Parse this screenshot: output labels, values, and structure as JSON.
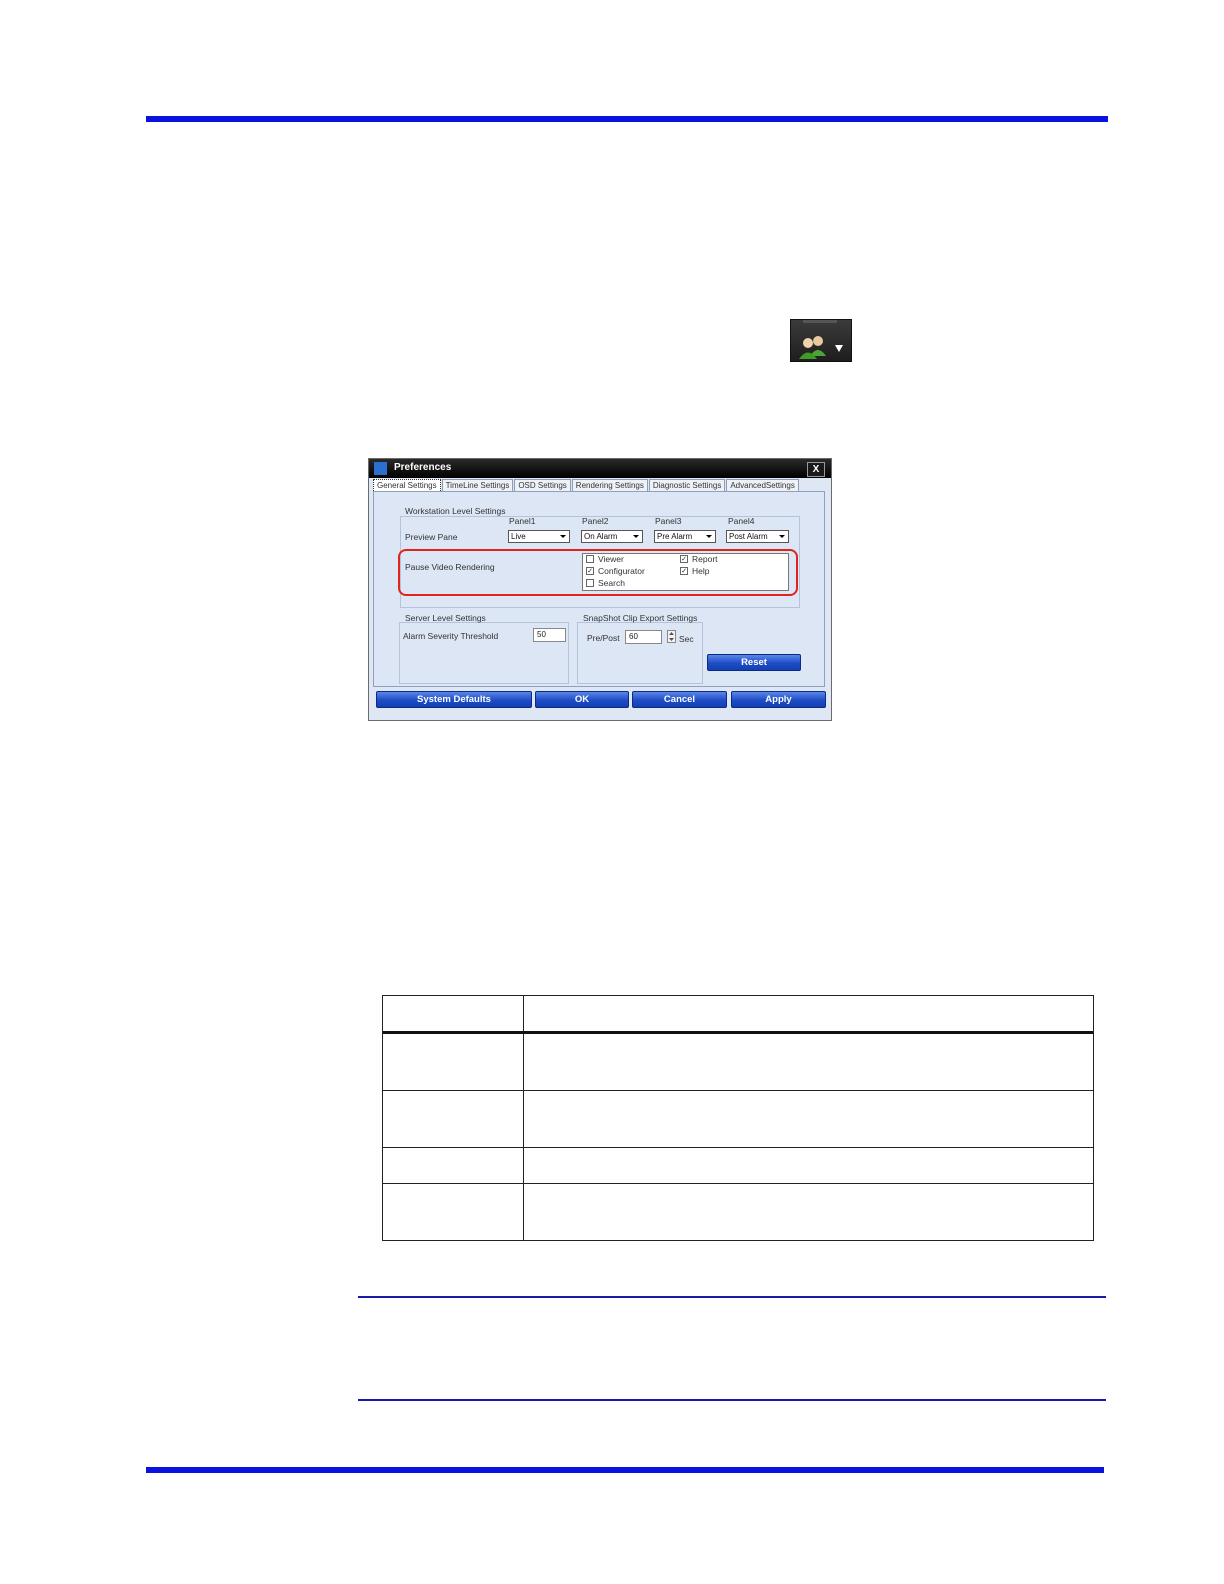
{
  "colors": {
    "rule": "#0a12e0",
    "accent_red": "#e0241b",
    "button_blue": "#1d4cc6"
  },
  "toolbar_icon": {
    "name": "users-icon",
    "dropdown": "chevron-down-icon"
  },
  "dialog": {
    "title": "Preferences",
    "close": "X",
    "tabs": [
      "General Settings",
      "TimeLine Settings",
      "OSD Settings",
      "Rendering Settings",
      "Diagnostic Settings",
      "AdvancedSettings"
    ],
    "active_tab": "General Settings",
    "workstation": {
      "group_label": "Workstation Level Settings",
      "preview_pane_label": "Preview Pane",
      "panels": [
        {
          "label": "Panel1",
          "value": "Live"
        },
        {
          "label": "Panel2",
          "value": "On Alarm"
        },
        {
          "label": "Panel3",
          "value": "Pre Alarm"
        },
        {
          "label": "Panel4",
          "value": "Post Alarm"
        }
      ],
      "pause_label": "Pause Video Rendering",
      "pause_options": [
        {
          "label": "Viewer",
          "checked": false
        },
        {
          "label": "Configurator",
          "checked": true
        },
        {
          "label": "Search",
          "checked": false
        },
        {
          "label": "Report",
          "checked": true
        },
        {
          "label": "Help",
          "checked": true
        }
      ]
    },
    "server": {
      "group_label": "Server Level Settings",
      "threshold_label": "Alarm Severity Threshold",
      "threshold_value": "50"
    },
    "snapshot": {
      "group_label": "SnapShot Clip Export Settings",
      "prepost_label": "Pre/Post",
      "prepost_value": "60",
      "unit": "Sec"
    },
    "reset_label": "Reset",
    "buttons": {
      "system_defaults": "System Defaults",
      "ok": "OK",
      "cancel": "Cancel",
      "apply": "Apply"
    }
  }
}
